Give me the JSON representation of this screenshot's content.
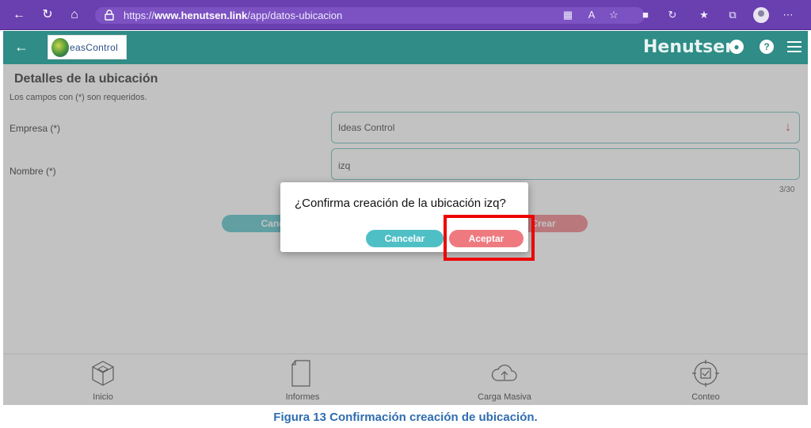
{
  "browser": {
    "url_prefix": "https://",
    "url_host": "www.henutsen.link",
    "url_path": "/app/datos-ubicacion"
  },
  "app": {
    "brand": "Henutsen",
    "logo_text": "easControl"
  },
  "page": {
    "title": "Detalles de la ubicación",
    "required_note": "Los campos con (*) son requeridos.",
    "empresa_label": "Empresa (*)",
    "empresa_value": "Ideas Control",
    "nombre_label": "Nombre (*)",
    "nombre_value": "izq",
    "nombre_counter": "3/30",
    "cancel_label": "Cancelar",
    "create_label": "Crear"
  },
  "dialog": {
    "message": "¿Confirma creación de la ubicación izq?",
    "cancel_label": "Cancelar",
    "accept_label": "Aceptar"
  },
  "bottom_nav": [
    {
      "label": "Inicio",
      "icon": "cube-icon"
    },
    {
      "label": "Informes",
      "icon": "document-icon"
    },
    {
      "label": "Carga Masiva",
      "icon": "cloud-upload-icon"
    },
    {
      "label": "Conteo",
      "icon": "scan-target-icon"
    }
  ],
  "caption": "Figura 13 Confirmación creación de ubicación.",
  "colors": {
    "header": "#2f8c86",
    "browser": "#6a3fb0",
    "cancel_button": "#4fbfc6",
    "accept_button": "#ee7a80",
    "highlight": "#ee0000"
  }
}
